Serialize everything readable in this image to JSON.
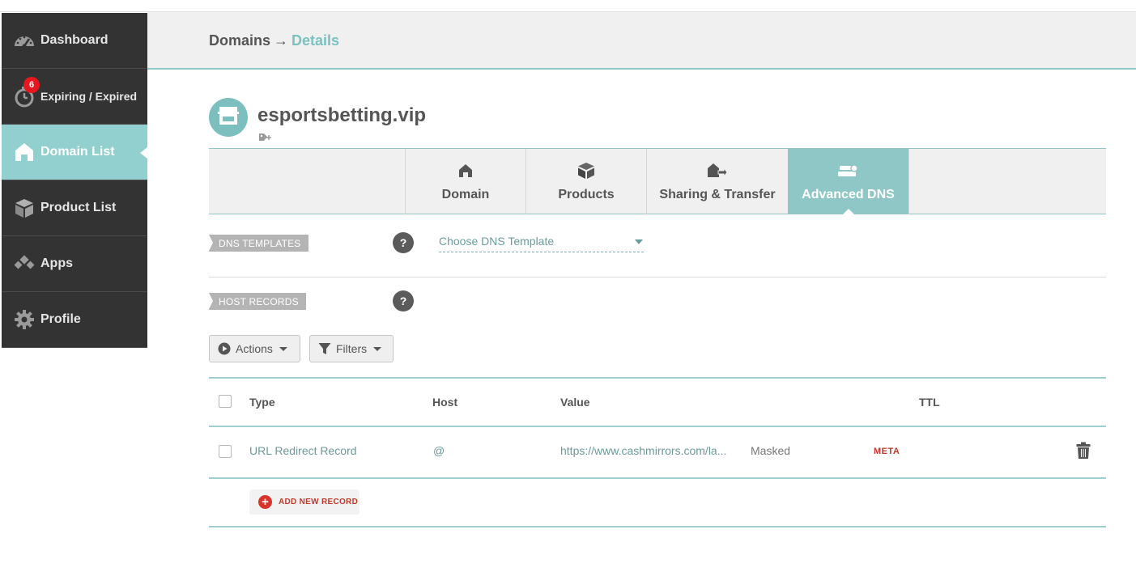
{
  "sidebar": {
    "items": [
      {
        "label": "Dashboard",
        "icon": "speedometer-icon"
      },
      {
        "label": "Expiring / Expired",
        "icon": "stopwatch-icon",
        "badge": "6"
      },
      {
        "label": "Domain List",
        "icon": "home-icon",
        "active": true
      },
      {
        "label": "Product List",
        "icon": "box-icon"
      },
      {
        "label": "Apps",
        "icon": "diamonds-icon"
      },
      {
        "label": "Profile",
        "icon": "gear-icon"
      }
    ]
  },
  "header": {
    "breadcrumb_root": "Domains",
    "breadcrumb_arrow": "→",
    "breadcrumb_current": "Details"
  },
  "domain": {
    "name": "esportsbetting.vip",
    "avatar_icon": "storefront-icon"
  },
  "tabs": [
    {
      "label": "Domain",
      "icon": "home-icon"
    },
    {
      "label": "Products",
      "icon": "box-icon"
    },
    {
      "label": "Sharing & Transfer",
      "icon": "share-house-icon"
    },
    {
      "label": "Advanced DNS",
      "icon": "server-icon",
      "active": true
    }
  ],
  "dns_templates": {
    "label": "DNS TEMPLATES",
    "help": "?",
    "select_value": "Choose DNS Template"
  },
  "host_records": {
    "label": "HOST RECORDS",
    "help": "?"
  },
  "toolbar": {
    "actions_label": "Actions",
    "filters_label": "Filters"
  },
  "table": {
    "columns": {
      "type": "Type",
      "host": "Host",
      "value": "Value",
      "ttl": "TTL"
    },
    "rows": [
      {
        "type": "URL Redirect Record",
        "host": "@",
        "value": "https://www.cashmirrors.com/la...",
        "redirect_mode": "Masked",
        "ttl_tag": "META"
      }
    ],
    "add_label": "ADD NEW RECORD"
  },
  "colors": {
    "accent": "#8ec7c6",
    "sidebar_bg": "#333333",
    "badge": "#e8171f",
    "danger": "#c0392b"
  }
}
